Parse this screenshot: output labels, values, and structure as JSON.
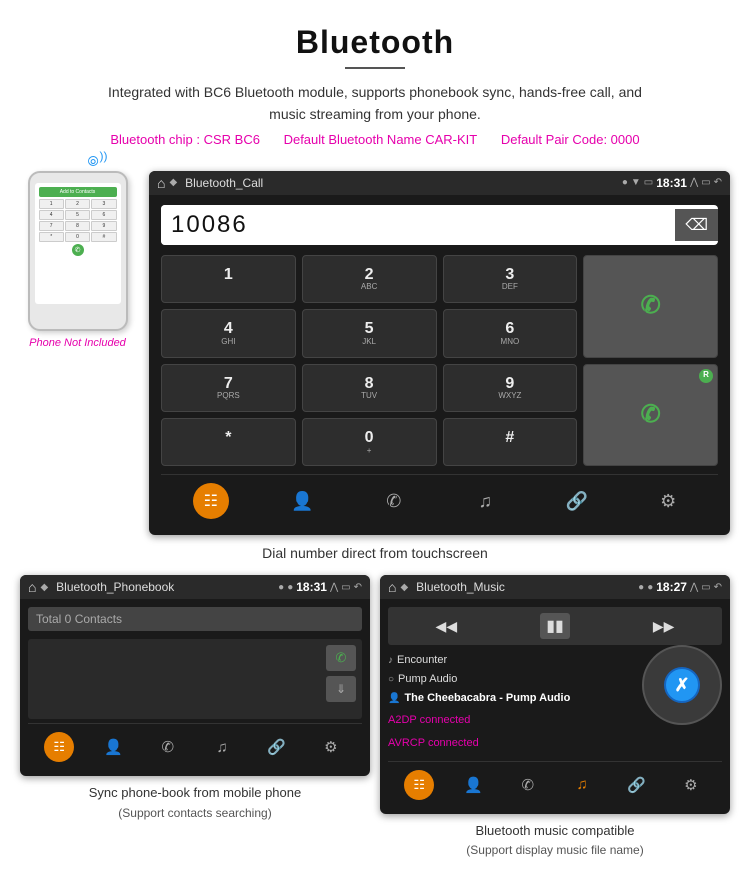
{
  "page": {
    "title": "Bluetooth",
    "description": "Integrated with BC6 Bluetooth module, supports phonebook sync, hands-free call, and music streaming from your phone.",
    "specs": {
      "chip": "Bluetooth chip : CSR BC6",
      "name": "Default Bluetooth Name CAR-KIT",
      "pair_code": "Default Pair Code: 0000"
    }
  },
  "phone_label": "Phone Not Included",
  "dial_screen": {
    "title": "Bluetooth_Call",
    "time": "18:31",
    "number": "10086",
    "keys": [
      {
        "main": "1",
        "sub": ""
      },
      {
        "main": "2",
        "sub": "ABC"
      },
      {
        "main": "3",
        "sub": "DEF"
      },
      {
        "main": "*",
        "sub": ""
      },
      {
        "main": "4",
        "sub": "GHI"
      },
      {
        "main": "5",
        "sub": "JKL"
      },
      {
        "main": "6",
        "sub": "MNO"
      },
      {
        "main": "0",
        "sub": "+"
      },
      {
        "main": "7",
        "sub": "PQRS"
      },
      {
        "main": "8",
        "sub": "TUV"
      },
      {
        "main": "9",
        "sub": "WXYZ"
      },
      {
        "main": "#",
        "sub": ""
      }
    ]
  },
  "dial_caption": "Dial number direct from touchscreen",
  "phonebook_screen": {
    "title": "Bluetooth_Phonebook",
    "time": "18:31",
    "search_placeholder": "Total 0 Contacts"
  },
  "phonebook_caption": "Sync phone-book from mobile phone",
  "phonebook_subcaption": "(Support contacts searching)",
  "music_screen": {
    "title": "Bluetooth_Music",
    "time": "18:27",
    "tracks": [
      {
        "icon": "♪",
        "name": "Encounter"
      },
      {
        "icon": "○",
        "name": "Pump Audio"
      },
      {
        "icon": "👤",
        "name": "The Cheebacabra - Pump Audio"
      }
    ],
    "connected": [
      "A2DP connected",
      "AVRCP connected"
    ]
  },
  "music_caption": "Bluetooth music compatible",
  "music_subcaption": "(Support display music file name)"
}
